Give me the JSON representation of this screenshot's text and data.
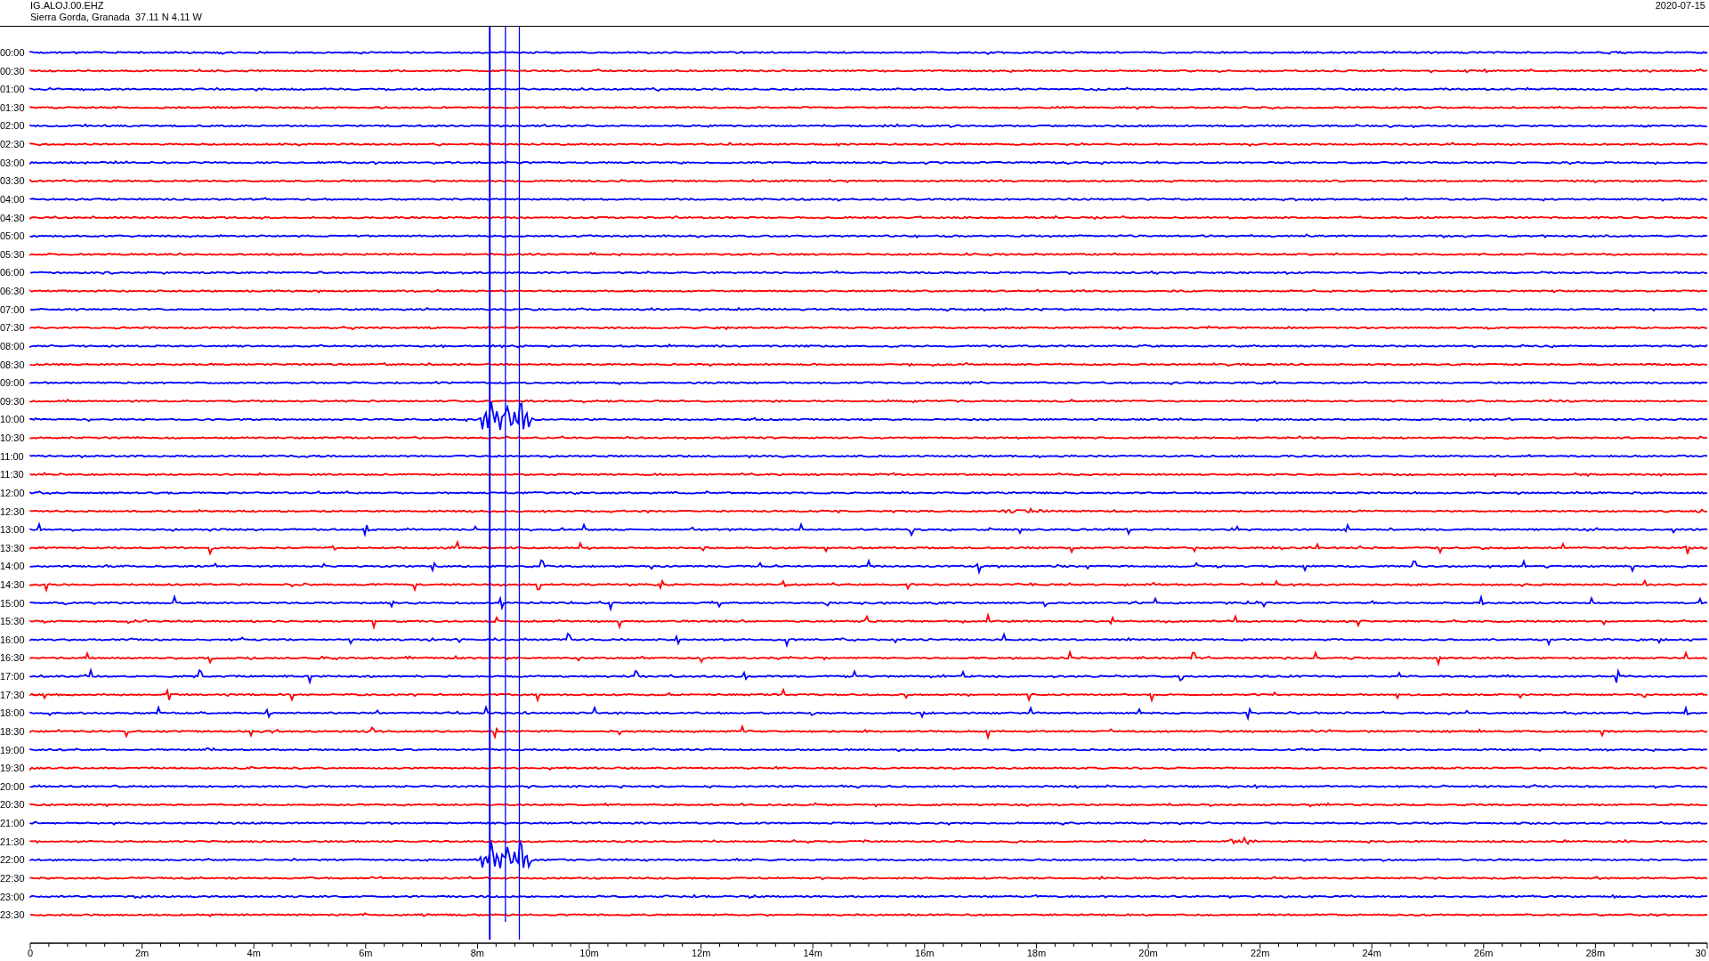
{
  "header": {
    "station": "IG.ALOJ.00.EHZ",
    "location": "Sierra Gorda, Granada  37.11 N 4.11 W",
    "date": "2020-07-15"
  },
  "rows": [
    {
      "label": "00:00",
      "color": "#0000ff"
    },
    {
      "label": "00:30",
      "color": "#ff0000"
    },
    {
      "label": "01:00",
      "color": "#0000ff"
    },
    {
      "label": "01:30",
      "color": "#ff0000"
    },
    {
      "label": "02:00",
      "color": "#0000ff"
    },
    {
      "label": "02:30",
      "color": "#ff0000"
    },
    {
      "label": "03:00",
      "color": "#0000ff"
    },
    {
      "label": "03:30",
      "color": "#ff0000"
    },
    {
      "label": "04:00",
      "color": "#0000ff"
    },
    {
      "label": "04:30",
      "color": "#ff0000"
    },
    {
      "label": "05:00",
      "color": "#0000ff"
    },
    {
      "label": "05:30",
      "color": "#ff0000"
    },
    {
      "label": "06:00",
      "color": "#0000ff"
    },
    {
      "label": "06:30",
      "color": "#ff0000"
    },
    {
      "label": "07:00",
      "color": "#0000ff"
    },
    {
      "label": "07:30",
      "color": "#ff0000"
    },
    {
      "label": "08:00",
      "color": "#0000ff"
    },
    {
      "label": "08:30",
      "color": "#ff0000"
    },
    {
      "label": "09:00",
      "color": "#0000ff"
    },
    {
      "label": "09:30",
      "color": "#ff0000"
    },
    {
      "label": "10:00",
      "color": "#0000ff"
    },
    {
      "label": "10:30",
      "color": "#ff0000"
    },
    {
      "label": "11:00",
      "color": "#0000ff"
    },
    {
      "label": "11:30",
      "color": "#ff0000"
    },
    {
      "label": "12:00",
      "color": "#0000ff"
    },
    {
      "label": "12:30",
      "color": "#ff0000"
    },
    {
      "label": "13:00",
      "color": "#0000ff"
    },
    {
      "label": "13:30",
      "color": "#ff0000"
    },
    {
      "label": "14:00",
      "color": "#0000ff"
    },
    {
      "label": "14:30",
      "color": "#ff0000"
    },
    {
      "label": "15:00",
      "color": "#0000ff"
    },
    {
      "label": "15:30",
      "color": "#ff0000"
    },
    {
      "label": "16:00",
      "color": "#0000ff"
    },
    {
      "label": "16:30",
      "color": "#ff0000"
    },
    {
      "label": "17:00",
      "color": "#0000ff"
    },
    {
      "label": "17:30",
      "color": "#ff0000"
    },
    {
      "label": "18:00",
      "color": "#0000ff"
    },
    {
      "label": "18:30",
      "color": "#ff0000"
    },
    {
      "label": "19:00",
      "color": "#0000ff"
    },
    {
      "label": "19:30",
      "color": "#ff0000"
    },
    {
      "label": "20:00",
      "color": "#0000ff"
    },
    {
      "label": "20:30",
      "color": "#ff0000"
    },
    {
      "label": "21:00",
      "color": "#0000ff"
    },
    {
      "label": "21:30",
      "color": "#ff0000"
    },
    {
      "label": "22:00",
      "color": "#0000ff"
    },
    {
      "label": "22:30",
      "color": "#ff0000"
    },
    {
      "label": "23:00",
      "color": "#0000ff"
    },
    {
      "label": "23:30",
      "color": "#ff0000"
    }
  ],
  "x_axis": {
    "ticks": [
      "0",
      "2m",
      "4m",
      "6m",
      "8m",
      "10m",
      "12m",
      "14m",
      "16m",
      "18m",
      "20m",
      "22m",
      "24m",
      "26m",
      "28m",
      "30"
    ]
  }
}
